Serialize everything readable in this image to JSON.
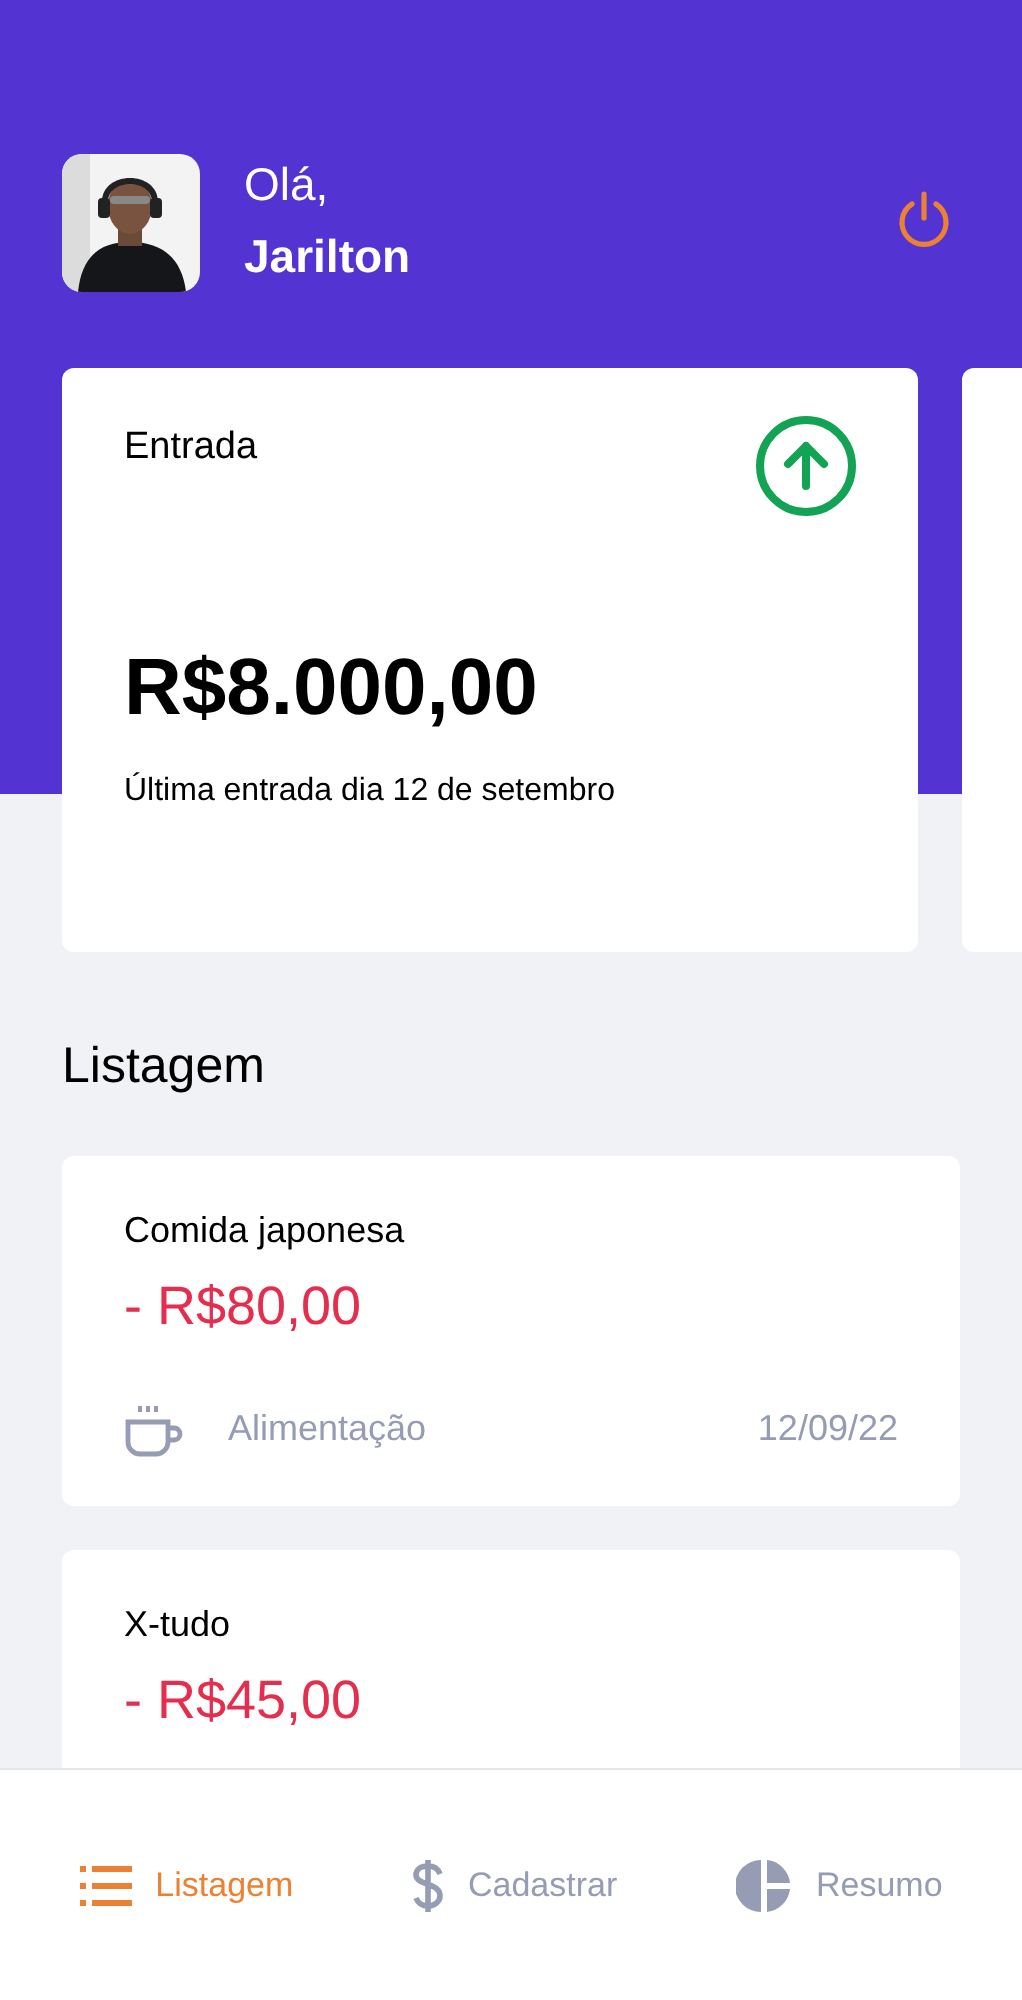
{
  "header": {
    "greeting": "Olá,",
    "user_name": "Jarilton"
  },
  "summary_cards": [
    {
      "kind": "income",
      "title": "Entrada",
      "amount": "R$8.000,00",
      "note": "Última entrada dia 12 de setembro"
    },
    {
      "kind": "blank"
    }
  ],
  "list_title": "Listagem",
  "transactions": [
    {
      "title": "Comida japonesa",
      "amount": "- R$80,00",
      "kind": "expense",
      "category": {
        "kind": "food",
        "label": "Alimentação"
      },
      "date": "12/09/22"
    },
    {
      "title": "X-tudo",
      "amount": "- R$45,00",
      "kind": "expense"
    }
  ],
  "nav": [
    {
      "label": "Listagem",
      "kind": "list",
      "selected": true
    },
    {
      "label": "Cadastrar",
      "kind": "dollar",
      "selected": false
    },
    {
      "label": "Resumo",
      "kind": "pie",
      "selected": false
    }
  ]
}
